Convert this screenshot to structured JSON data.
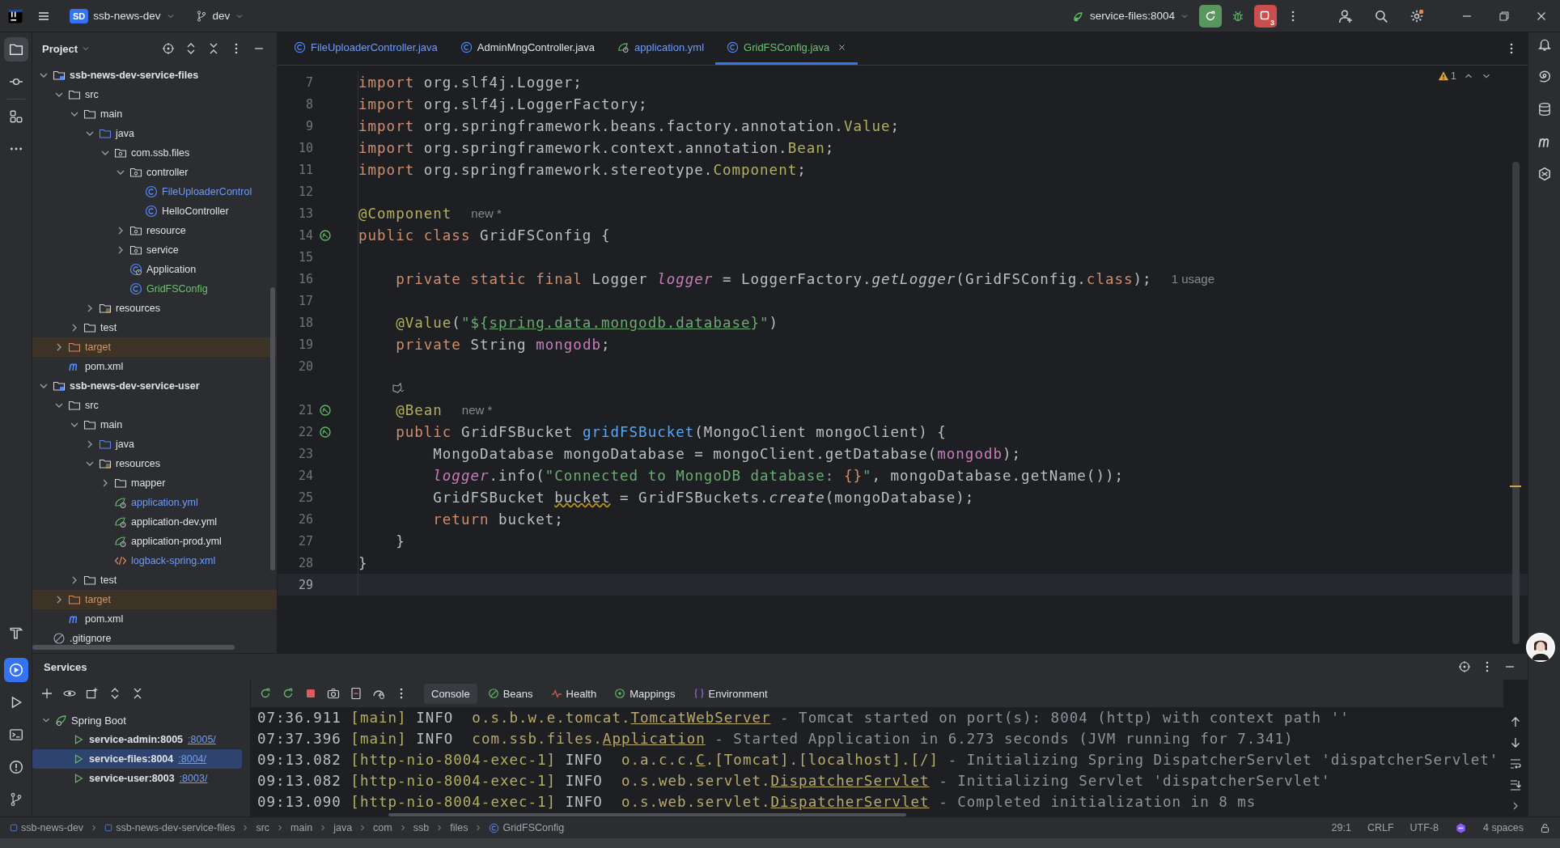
{
  "title_bar": {
    "project_badge": "SD",
    "project": "ssb-news-dev",
    "branch": "dev",
    "run_config": "service-files:8004",
    "stop_count": "3"
  },
  "project_panel": {
    "title": "Project",
    "tree": [
      {
        "label": "ssb-news-dev-service-files",
        "kind": "module",
        "expanded": true,
        "children": [
          {
            "label": "src",
            "kind": "folder",
            "expanded": true,
            "children": [
              {
                "label": "main",
                "kind": "folder",
                "expanded": true,
                "children": [
                  {
                    "label": "java",
                    "kind": "source",
                    "expanded": true,
                    "children": [
                      {
                        "label": "com.ssb.files",
                        "kind": "package",
                        "expanded": true,
                        "children": [
                          {
                            "label": "controller",
                            "kind": "package",
                            "expanded": true,
                            "children": [
                              {
                                "label": "FileUploaderControl",
                                "kind": "class",
                                "color": "#6f9cf6"
                              },
                              {
                                "label": "HelloController",
                                "kind": "class"
                              }
                            ]
                          },
                          {
                            "label": "resource",
                            "kind": "package",
                            "expanded": false
                          },
                          {
                            "label": "service",
                            "kind": "package",
                            "expanded": false
                          },
                          {
                            "label": "Application",
                            "kind": "spring-class"
                          },
                          {
                            "label": "GridFSConfig",
                            "kind": "class",
                            "color": "#73bd79"
                          }
                        ]
                      }
                    ]
                  },
                  {
                    "label": "resources",
                    "kind": "resources",
                    "expanded": false
                  }
                ]
              },
              {
                "label": "test",
                "kind": "folder",
                "expanded": false
              }
            ]
          },
          {
            "label": "target",
            "kind": "excluded",
            "expanded": false,
            "color": "#d19567"
          },
          {
            "label": "pom.xml",
            "kind": "maven"
          }
        ]
      },
      {
        "label": "ssb-news-dev-service-user",
        "kind": "module",
        "expanded": true,
        "children": [
          {
            "label": "src",
            "kind": "folder",
            "expanded": true,
            "children": [
              {
                "label": "main",
                "kind": "folder",
                "expanded": true,
                "children": [
                  {
                    "label": "java",
                    "kind": "source",
                    "expanded": false
                  },
                  {
                    "label": "resources",
                    "kind": "resources",
                    "expanded": true,
                    "children": [
                      {
                        "label": "mapper",
                        "kind": "folder",
                        "expanded": false
                      },
                      {
                        "label": "application.yml",
                        "kind": "yaml",
                        "color": "#6f9cf6"
                      },
                      {
                        "label": "application-dev.yml",
                        "kind": "yaml"
                      },
                      {
                        "label": "application-prod.yml",
                        "kind": "yaml"
                      },
                      {
                        "label": "logback-spring.xml",
                        "kind": "xml",
                        "color": "#6f9cf6"
                      }
                    ]
                  }
                ]
              },
              {
                "label": "test",
                "kind": "folder",
                "expanded": false
              }
            ]
          },
          {
            "label": "target",
            "kind": "excluded",
            "expanded": false,
            "color": "#d19567"
          },
          {
            "label": "pom.xml",
            "kind": "maven"
          }
        ]
      },
      {
        "label": ".gitignore",
        "kind": "ignore"
      }
    ]
  },
  "editor": {
    "tabs": [
      {
        "label": "FileUploaderController.java",
        "kind": "class",
        "color": "#6f9cf6",
        "selected": false
      },
      {
        "label": "AdminMngController.java",
        "kind": "class",
        "selected": false
      },
      {
        "label": "application.yml",
        "kind": "yaml",
        "color": "#6f9cf6",
        "selected": false
      },
      {
        "label": "GridFSConfig.java",
        "kind": "class",
        "color": "#73bd79",
        "selected": true
      }
    ],
    "warning_count": "1",
    "lines": [
      {
        "kind": "code",
        "number": "7",
        "current": false,
        "tokens": [
          {
            "kind": "kw",
            "t": "import"
          },
          {
            "kind": "p",
            "t": " org.slf4j.Logger;"
          }
        ]
      },
      {
        "kind": "code",
        "number": "8",
        "current": false,
        "tokens": [
          {
            "kind": "kw",
            "t": "import"
          },
          {
            "kind": "p",
            "t": " org.slf4j.LoggerFactory;"
          }
        ]
      },
      {
        "kind": "code",
        "number": "9",
        "current": false,
        "tokens": [
          {
            "kind": "kw",
            "t": "import"
          },
          {
            "kind": "p",
            "t": " org.springframework.beans.factory.annotation."
          },
          {
            "kind": "ann",
            "t": "Value"
          },
          {
            "kind": "p",
            "t": ";"
          }
        ]
      },
      {
        "kind": "code",
        "number": "10",
        "current": false,
        "tokens": [
          {
            "kind": "kw",
            "t": "import"
          },
          {
            "kind": "p",
            "t": " org.springframework.context.annotation."
          },
          {
            "kind": "ann",
            "t": "Bean"
          },
          {
            "kind": "p",
            "t": ";"
          }
        ]
      },
      {
        "kind": "code",
        "number": "11",
        "current": false,
        "tokens": [
          {
            "kind": "kw",
            "t": "import"
          },
          {
            "kind": "p",
            "t": " org.springframework.stereotype."
          },
          {
            "kind": "ann",
            "t": "Component"
          },
          {
            "kind": "p",
            "t": ";"
          }
        ]
      },
      {
        "kind": "code",
        "number": "12",
        "current": false
      },
      {
        "kind": "code",
        "number": "13",
        "current": false,
        "tokens": [
          {
            "kind": "ann",
            "t": "@Component"
          }
        ],
        "hint": "new *"
      },
      {
        "kind": "code",
        "number": "14",
        "current": false,
        "bean_marker": true,
        "tokens": [
          {
            "kind": "kw",
            "t": "public class "
          },
          {
            "kind": "p",
            "t": "GridFSConfig {"
          }
        ]
      },
      {
        "kind": "code",
        "number": "15",
        "current": false
      },
      {
        "kind": "code",
        "number": "16",
        "current": false,
        "tokens": [
          {
            "kind": "kw",
            "t": "    private static final "
          },
          {
            "kind": "p",
            "t": "Logger "
          },
          {
            "kind": "fi",
            "t": "logger"
          },
          {
            "kind": "p",
            "t": " = LoggerFactory."
          },
          {
            "kind": "i",
            "t": "getLogger"
          },
          {
            "kind": "p",
            "t": "(GridFSConfig."
          },
          {
            "kind": "kw",
            "t": "class"
          },
          {
            "kind": "p",
            "t": ");"
          }
        ],
        "hint": "1 usage"
      },
      {
        "kind": "code",
        "number": "17",
        "current": false
      },
      {
        "kind": "code",
        "number": "18",
        "current": false,
        "tokens": [
          {
            "kind": "ann",
            "t": "    @Value"
          },
          {
            "kind": "p",
            "t": "("
          },
          {
            "kind": "str",
            "t": "\"${"
          },
          {
            "kind": "strl",
            "t": "spring.data.mongodb.database"
          },
          {
            "kind": "str",
            "t": "}\""
          },
          {
            "kind": "p",
            "t": ")"
          }
        ]
      },
      {
        "kind": "code",
        "number": "19",
        "current": false,
        "tokens": [
          {
            "kind": "kw",
            "t": "    private "
          },
          {
            "kind": "p",
            "t": "String "
          },
          {
            "kind": "f",
            "t": "mongodb"
          },
          {
            "kind": "p",
            "t": ";"
          }
        ]
      },
      {
        "kind": "code",
        "number": "20",
        "current": false
      },
      {
        "kind": "vision",
        "current": false
      },
      {
        "kind": "code",
        "number": "21",
        "current": false,
        "bean_marker": true,
        "tokens": [
          {
            "kind": "ann",
            "t": "    @Bean"
          }
        ],
        "hint": "new *"
      },
      {
        "kind": "code",
        "number": "22",
        "current": false,
        "bean_marker": true,
        "tokens": [
          {
            "kind": "kw",
            "t": "    public "
          },
          {
            "kind": "p",
            "t": "GridFSBucket "
          },
          {
            "kind": "fn",
            "t": "gridFSBucket"
          },
          {
            "kind": "p",
            "t": "(MongoClient mongoClient) {"
          }
        ]
      },
      {
        "kind": "code",
        "number": "23",
        "current": false,
        "tokens": [
          {
            "kind": "p",
            "t": "        MongoDatabase mongoDatabase = mongoClient.getDatabase("
          },
          {
            "kind": "f",
            "t": "mongodb"
          },
          {
            "kind": "p",
            "t": ");"
          }
        ]
      },
      {
        "kind": "code",
        "number": "24",
        "current": false,
        "tokens": [
          {
            "kind": "fi",
            "t": "        logger"
          },
          {
            "kind": "p",
            "t": ".info("
          },
          {
            "kind": "str",
            "t": "\"Connected to MongoDB database: "
          },
          {
            "kind": "kw",
            "t": "{}"
          },
          {
            "kind": "str",
            "t": "\""
          },
          {
            "kind": "p",
            "t": ", mongoDatabase.getName());"
          }
        ]
      },
      {
        "kind": "code",
        "number": "25",
        "current": false,
        "tokens": [
          {
            "kind": "p",
            "t": "        GridFSBucket "
          },
          {
            "kind": "warn",
            "t": "bucket"
          },
          {
            "kind": "p",
            "t": " = GridFSBuckets."
          },
          {
            "kind": "i",
            "t": "create"
          },
          {
            "kind": "p",
            "t": "(mongoDatabase);"
          }
        ]
      },
      {
        "kind": "code",
        "number": "26",
        "current": false,
        "tokens": [
          {
            "kind": "kw",
            "t": "        return"
          },
          {
            "kind": "p",
            "t": " bucket;"
          }
        ]
      },
      {
        "kind": "code",
        "number": "27",
        "current": false,
        "tokens": [
          {
            "kind": "p",
            "t": "    }"
          }
        ]
      },
      {
        "kind": "code",
        "number": "28",
        "current": false,
        "tokens": [
          {
            "kind": "p",
            "t": "}"
          }
        ]
      },
      {
        "kind": "code",
        "number": "29",
        "current": true
      }
    ]
  },
  "services": {
    "title": "Services",
    "tree": {
      "label": "Spring Boot",
      "expanded": true,
      "children": [
        {
          "label": "service-admin:8005",
          "link": ":8005/",
          "selected": false
        },
        {
          "label": "service-files:8004",
          "link": ":8004/",
          "selected": true
        },
        {
          "label": "service-user:8003",
          "link": ":8003/",
          "selected": false
        }
      ]
    },
    "tabs": [
      {
        "label": "Console",
        "kind": "console",
        "selected": true
      },
      {
        "label": "Beans",
        "kind": "beans",
        "selected": false
      },
      {
        "label": "Health",
        "kind": "health",
        "selected": false
      },
      {
        "label": "Mappings",
        "kind": "mappings",
        "selected": false
      },
      {
        "label": "Environment",
        "kind": "environment",
        "selected": false
      }
    ],
    "console": [
      {
        "tokens": [
          {
            "kind": "time",
            "t": "07:36.911 "
          },
          {
            "kind": "thread",
            "t": "[main] "
          },
          {
            "kind": "level",
            "t": "INFO  "
          },
          {
            "kind": "logger",
            "t": "o.s.b.w.e.tomcat."
          },
          {
            "kind": "link",
            "t": "TomcatWebServer"
          },
          {
            "kind": "msg",
            "t": " - Tomcat started on port(s): 8004 (http) with context path ''"
          }
        ]
      },
      {
        "tokens": [
          {
            "kind": "time",
            "t": "07:37.396 "
          },
          {
            "kind": "thread",
            "t": "[main] "
          },
          {
            "kind": "level",
            "t": "INFO  "
          },
          {
            "kind": "logger",
            "t": "com.ssb.files."
          },
          {
            "kind": "link",
            "t": "Application"
          },
          {
            "kind": "msg",
            "t": " - Started Application in 6.273 seconds (JVM running for 7.341)"
          }
        ]
      },
      {
        "tokens": [
          {
            "kind": "time",
            "t": "09:13.082 "
          },
          {
            "kind": "thread",
            "t": "[http-nio-8004-exec-1] "
          },
          {
            "kind": "level",
            "t": "INFO  "
          },
          {
            "kind": "logger",
            "t": "o.a.c.c."
          },
          {
            "kind": "link",
            "t": "C"
          },
          {
            "kind": "logger",
            "t": ".[Tomcat].[localhost].[/]"
          },
          {
            "kind": "msg",
            "t": " - Initializing Spring DispatcherServlet 'dispatcherServlet'"
          }
        ]
      },
      {
        "tokens": [
          {
            "kind": "time",
            "t": "09:13.082 "
          },
          {
            "kind": "thread",
            "t": "[http-nio-8004-exec-1] "
          },
          {
            "kind": "level",
            "t": "INFO  "
          },
          {
            "kind": "logger",
            "t": "o.s.web.servlet."
          },
          {
            "kind": "link",
            "t": "DispatcherServlet"
          },
          {
            "kind": "msg",
            "t": " - Initializing Servlet 'dispatcherServlet'"
          }
        ]
      },
      {
        "tokens": [
          {
            "kind": "time",
            "t": "09:13.090 "
          },
          {
            "kind": "thread",
            "t": "[http-nio-8004-exec-1] "
          },
          {
            "kind": "level",
            "t": "INFO  "
          },
          {
            "kind": "logger",
            "t": "o.s.web.servlet."
          },
          {
            "kind": "link",
            "t": "DispatcherServlet"
          },
          {
            "kind": "msg",
            "t": " - Completed initialization in 8 ms"
          }
        ]
      }
    ]
  },
  "status_bar": {
    "breadcrumbs": [
      {
        "label": "ssb-news-dev",
        "kind": "module"
      },
      {
        "label": "ssb-news-dev-service-files",
        "kind": "module"
      },
      {
        "label": "src"
      },
      {
        "label": "main"
      },
      {
        "label": "java"
      },
      {
        "label": "com"
      },
      {
        "label": "ssb"
      },
      {
        "label": "files"
      },
      {
        "label": "GridFSConfig",
        "kind": "class"
      }
    ],
    "position": "29:1",
    "line_ending": "CRLF",
    "encoding": "UTF-8",
    "indent": "4 spaces"
  }
}
